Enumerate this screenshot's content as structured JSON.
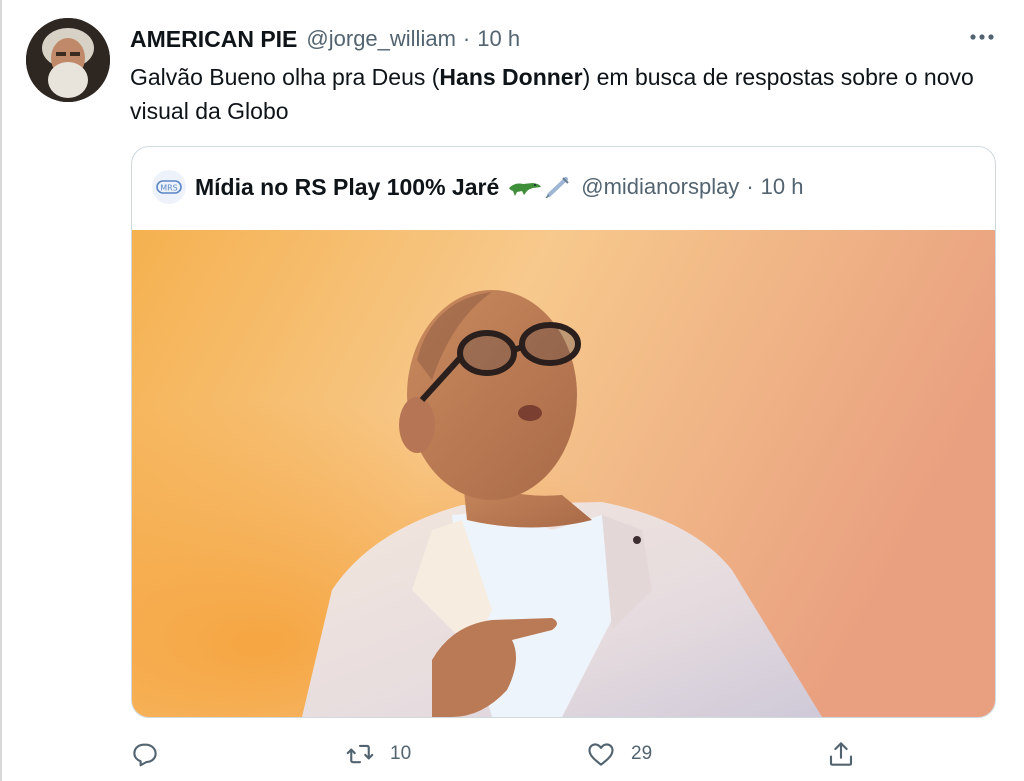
{
  "tweet": {
    "display_name": "AMERICAN PIE",
    "handle": "@jorge_william",
    "separator": "·",
    "time": "10 h",
    "text_before": "Galvão Bueno olha pra Deus (",
    "text_bold": "Hans Donner",
    "text_after": ") em busca de respostas sobre o novo visual da Globo"
  },
  "quoted_tweet": {
    "display_name": "Mídia no RS Play 100% Jaré",
    "emoji_icons": [
      "alligator-icon",
      "syringe-icon"
    ],
    "handle": "@midianorsplay",
    "separator": "·",
    "time": "10 h"
  },
  "actions": {
    "reply": {
      "icon": "reply-icon"
    },
    "retweet": {
      "icon": "retweet-icon",
      "count": "10"
    },
    "like": {
      "icon": "heart-icon",
      "count": "29"
    },
    "share": {
      "icon": "share-icon"
    }
  },
  "colors": {
    "primary_text": "#0f1419",
    "secondary_text": "#536471",
    "border": "#cfd9de",
    "photo_warm": "#f2a94a"
  }
}
